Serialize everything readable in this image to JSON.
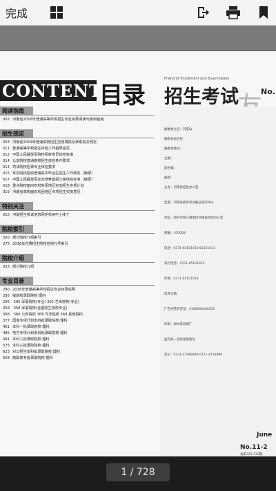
{
  "toolbar": {
    "done_label": "完成",
    "icons": [
      "grid-icon",
      "exit-icon",
      "print-icon",
      "bookmark-icon"
    ]
  },
  "magazine": {
    "contents_label": "CONTENTS",
    "mulu": "目录",
    "english_line": "Friend of Enrollment and Examination",
    "title": "招生考试",
    "logo_char": "友",
    "issue": "No.11"
  },
  "toc": [
    {
      "section": "阅读指南",
      "items": [
        {
          "pg": "002",
          "text": "河南省2016年普通高等学校招生专业目录阅读与使用指南"
        }
      ]
    },
    {
      "section": "招生规定",
      "items": [
        {
          "pg": "003",
          "text": "河南省2016年普通高校招生志愿填报及录取有关规定"
        },
        {
          "pg": "011",
          "text": "普通高等学校招生体检工作指导意见"
        },
        {
          "pg": "012",
          "text": "中国人民解放军院校招收学员体检标准"
        },
        {
          "pg": "014",
          "text": "公安院校普通高校招生体检条件要求"
        },
        {
          "pg": "014",
          "text": "司法院校招录专业体检要求"
        },
        {
          "pg": "015",
          "text": "军队院校招收普通高中毕业生招生工作规定（摘录）"
        },
        {
          "pg": "017",
          "text": "中国人民解放军定向培养直招士官体检标准（摘录）"
        },
        {
          "pg": "018",
          "text": "重点院校面向农村贫困地区定向招生专项计划"
        },
        {
          "pg": "019",
          "text": "河南省高校面向贫困地区专项招生实施意见"
        }
      ]
    },
    {
      "section": "特别关注",
      "items": [
        {
          "pg": "010",
          "text": "河南招生考试信息网手机APP上线了"
        }
      ]
    },
    {
      "section": "院校索引",
      "items": [
        {
          "pg": "030",
          "text": "部分院校介绍索引"
        },
        {
          "pg": "275",
          "text": "2016年在豫招生院校名称代号索引"
        }
      ]
    },
    {
      "section": "院校介绍",
      "items": [
        {
          "pg": "033",
          "text": "部分院校介绍"
        }
      ]
    },
    {
      "section": "专业目录",
      "items": [
        {
          "pg": "290",
          "text": "2016年普通高等学校招生专业目录说明"
        },
        {
          "pg": "295",
          "text": "提前批录取院校·理科"
        },
        {
          "pg": "295",
          "text": "      295 军事院校(专业)  302 艺术院校(专业)"
        },
        {
          "pg": "358",
          "text": "      358 军事院校(含国防生院校专业)"
        },
        {
          "pg": "366",
          "text": "      366 公安院校  368 司法院校  369 其他院校"
        },
        {
          "pg": "377",
          "text": "国家专项计划本科批录取院校·理科"
        },
        {
          "pg": "401",
          "text": "本科一批录取院校·理科"
        },
        {
          "pg": "485",
          "text": "地方专项计划本科批录取院校·理科"
        },
        {
          "pg": "491",
          "text": "本科二批录取院校·理科"
        },
        {
          "pg": "575",
          "text": "本科三批录取院校·理科"
        },
        {
          "pg": "623",
          "text": "对口招生本科批录取院校·理科"
        },
        {
          "pg": "628",
          "text": "高职高专批录取院校·理科"
        }
      ]
    }
  ],
  "right_column": {
    "lines": [
      "编委会主任：刘宏山",
      "编委会副主任：",
      "编委会委员：",
      "主编：",
      "副主编：",
      "编辑：",
      "主办：河南省招生办公室",
      "出版：河南省教育考试报业发行中心",
      "地址：郑州市经三路南段河南省招生办公室",
      "邮编：450008",
      "电话：0371-65101033  65101033",
      "发行电话：0371-65101033",
      "传真：0371-65101033",
      "电子信箱：",
      "广告经营许可证：4100004000052",
      "印刷：郑州某印刷厂",
      "国内统一连续出版物号",
      "定价：0371-47999999  0371-4719999"
    ],
    "month": "June",
    "bottom_no": "No.11-2",
    "bottom_small": "总第329-330期"
  },
  "pagination": {
    "current": "1",
    "total": "728",
    "label": "1 / 728"
  }
}
